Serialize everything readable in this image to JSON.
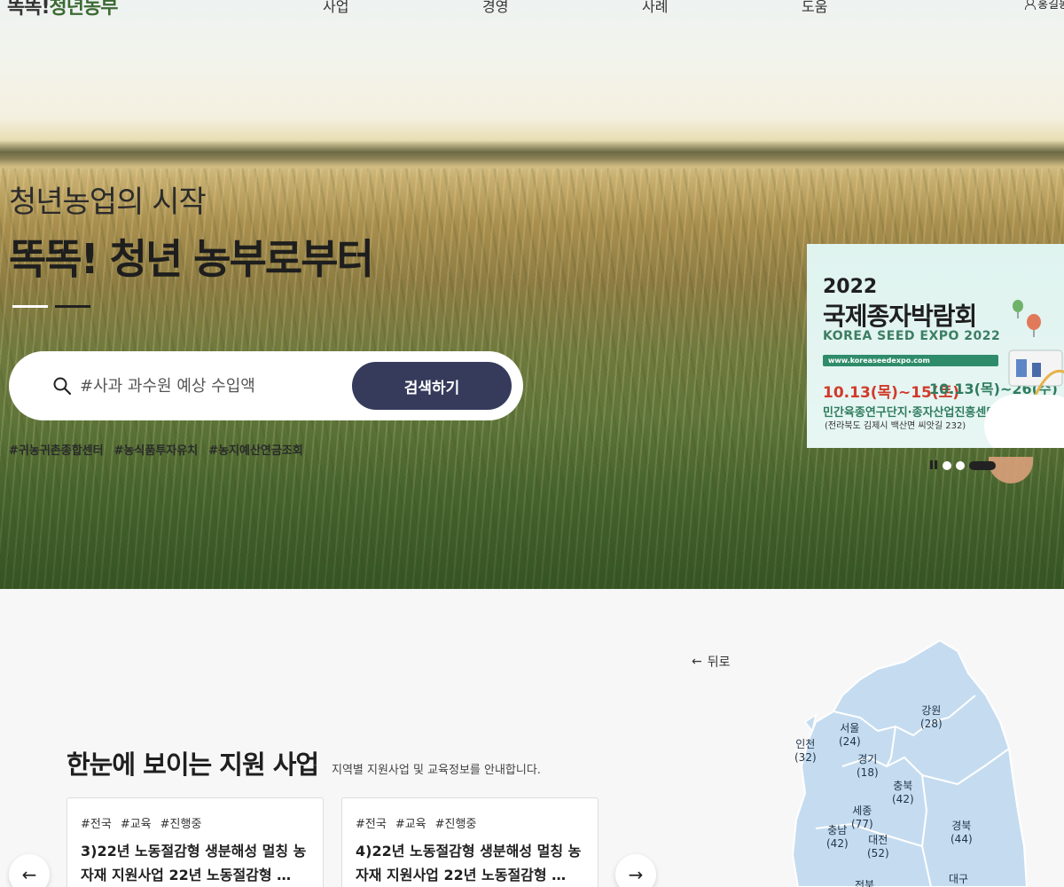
{
  "header": {
    "logo_part1": "똑똑!",
    "logo_part2": "청년농부",
    "nav": [
      "사업",
      "경영",
      "사례",
      "도움"
    ],
    "user_name": "홍길동"
  },
  "hero": {
    "subtitle": "청년농업의 시작",
    "title": "똑똑! 청년 농부로부터",
    "search_placeholder": "#사과 과수원 예상 수입액",
    "search_button": "검색하기",
    "tags": [
      "#귀농귀촌종합센터",
      "#농식품투자유치",
      "#농지예산연금조회"
    ]
  },
  "banner": {
    "year": "2022",
    "title": "국제종자박람회",
    "subtitle_en": "KOREA SEED EXPO 2022",
    "url": "www.koreaseedexpo.com",
    "date_main": "10.13(목)~15(토)",
    "date_online": "10.13(목)~26(수)",
    "venue": "민간육종연구단지·종자산업진흥센터",
    "address": "(전라북도 김제시 백산면 씨앗길 232)"
  },
  "slider": {
    "dots": 3,
    "active_index": 2
  },
  "support": {
    "title": "한눈에 보이는 지원 사업",
    "description": "지역별 지원사업 및 교육정보를 안내합니다.",
    "back_label": "뒤로",
    "cards": [
      {
        "tags": [
          "#전국",
          "#교육",
          "#진행중"
        ],
        "title": "3)22년 노동절감형 생분해성 멀칭 농자재 지원사업 22년 노동절감형 …"
      },
      {
        "tags": [
          "#전국",
          "#교육",
          "#진행중"
        ],
        "title": "4)22년 노동절감형 생분해성 멀칭 농자재 지원사업 22년 노동절감형 …"
      }
    ],
    "regions": [
      {
        "name": "강원",
        "count": "(28)"
      },
      {
        "name": "서울",
        "count": "(24)"
      },
      {
        "name": "인천",
        "count": "(32)"
      },
      {
        "name": "경기",
        "count": "(18)"
      },
      {
        "name": "충북",
        "count": "(42)"
      },
      {
        "name": "세종",
        "count": "(77)"
      },
      {
        "name": "충남",
        "count": "(42)"
      },
      {
        "name": "대전",
        "count": "(52)"
      },
      {
        "name": "경북",
        "count": "(44)"
      },
      {
        "name": "전북",
        "count": ""
      },
      {
        "name": "대구",
        "count": ""
      }
    ]
  },
  "colors": {
    "search_button": "#363b5c",
    "map_fill": "#c5dcf0",
    "banner_bg": "#dff3ef",
    "date_red": "#d23a2a",
    "banner_green": "#2f7c5e"
  }
}
